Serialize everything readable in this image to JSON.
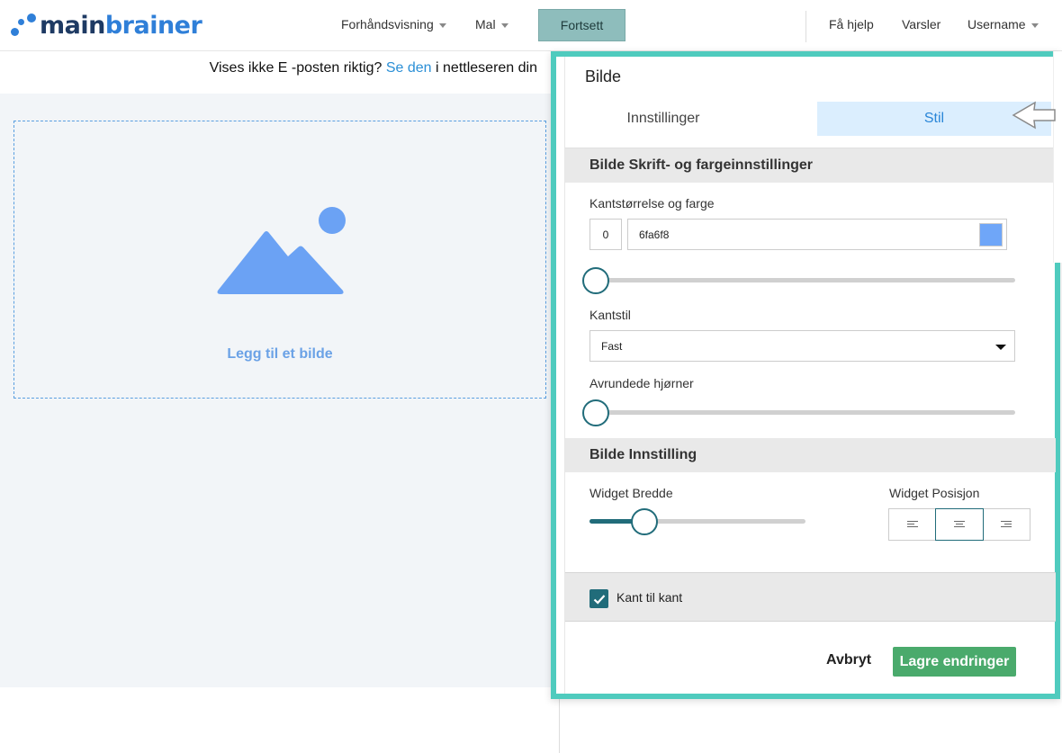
{
  "header": {
    "logo_part1": "main",
    "logo_part2": "brainer",
    "nav_preview": "Forhåndsvisning",
    "nav_template": "Mal",
    "continue_label": "Fortsett",
    "help_label": "Få hjelp",
    "alerts_label": "Varsler",
    "user_label": "Username"
  },
  "notice": {
    "text_before": "Vises ikke E -posten riktig?",
    "link_text": "Se den",
    "text_after": "i nettleseren din"
  },
  "canvas": {
    "add_image_label": "Legg til et bilde",
    "icon": "image-placeholder-icon"
  },
  "panel": {
    "title": "Bilde",
    "tabs": [
      {
        "label": "Innstillinger",
        "active": false
      },
      {
        "label": "Stil",
        "active": true
      }
    ],
    "section_font_color": "Bilde Skrift- og fargeinnstillinger",
    "border_size_color_label": "Kantstørrelse og farge",
    "border_size_value": "0",
    "border_color_value": "6fa6f8",
    "border_color_swatch": "#6fa6f8",
    "border_size_slider_value": 0,
    "border_style_label": "Kantstil",
    "border_style_value": "Fast",
    "rounded_corners_label": "Avrundede hjørner",
    "rounded_corners_slider_value": 0,
    "section_image_setting": "Bilde Innstilling",
    "widget_width_label": "Widget Bredde",
    "widget_width_slider_fraction": 0.25,
    "widget_position_label": "Widget Posisjon",
    "widget_position_options": [
      "left",
      "center",
      "right"
    ],
    "widget_position_selected": "center",
    "edge_to_edge_label": "Kant til kant",
    "edge_to_edge_checked": true,
    "cancel_label": "Avbryt",
    "save_label": "Lagre endringer"
  },
  "colors": {
    "accent_teal": "#4fcbbe",
    "continue_button": "#8ebdbc",
    "save_button": "#4aaa6c",
    "slider": "#216c7a",
    "link": "#2b8fd6",
    "active_tab_bg": "#dbeefe"
  }
}
